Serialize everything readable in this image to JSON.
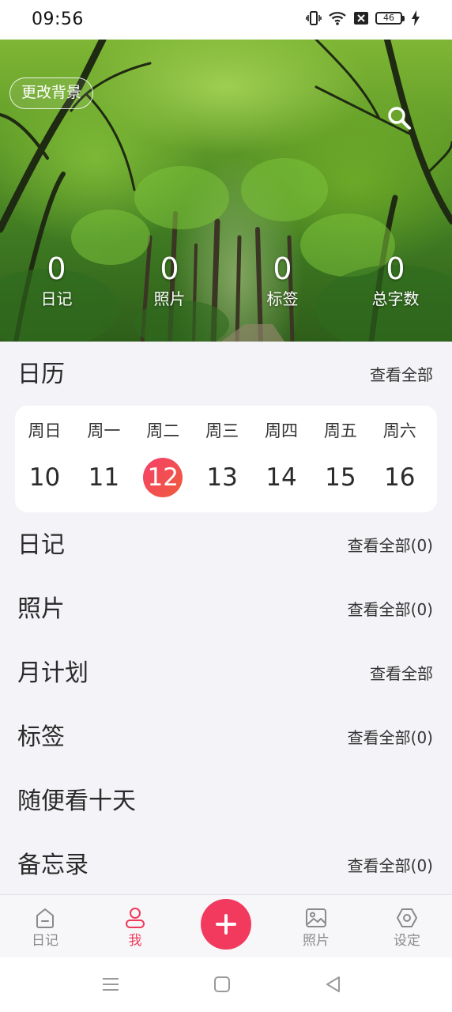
{
  "status_bar": {
    "time": "09:56",
    "battery_level": "46",
    "icons": [
      "vibrate-icon",
      "wifi-icon",
      "sim-off-icon",
      "battery-icon",
      "charging-icon"
    ]
  },
  "hero": {
    "change_background_label": "更改背景",
    "search_icon": "search-icon",
    "stats": [
      {
        "value": "0",
        "label": "日记"
      },
      {
        "value": "0",
        "label": "照片"
      },
      {
        "value": "0",
        "label": "标签"
      },
      {
        "value": "0",
        "label": "总字数"
      }
    ]
  },
  "calendar": {
    "title": "日历",
    "link": "查看全部",
    "weekdays": [
      "周日",
      "周一",
      "周二",
      "周三",
      "周四",
      "周五",
      "周六"
    ],
    "dates": [
      "10",
      "11",
      "12",
      "13",
      "14",
      "15",
      "16"
    ],
    "today": "12"
  },
  "sections": {
    "diary": {
      "title": "日记",
      "link": "查看全部(0)"
    },
    "photos": {
      "title": "照片",
      "link": "查看全部(0)"
    },
    "monthly_plan": {
      "title": "月计划",
      "link": "查看全部"
    },
    "tags": {
      "title": "标签",
      "link": "查看全部(0)"
    },
    "random_ten_days": {
      "title": "随便看十天"
    },
    "memo": {
      "title": "备忘录",
      "link": "查看全部(0)"
    }
  },
  "tab_bar": {
    "tabs": [
      {
        "label": "日记",
        "icon": "home-icon",
        "active": false
      },
      {
        "label": "我",
        "icon": "person-icon",
        "active": true
      },
      {
        "label": "",
        "icon": "plus-icon",
        "active": false
      },
      {
        "label": "照片",
        "icon": "image-icon",
        "active": false
      },
      {
        "label": "设定",
        "icon": "settings-icon",
        "active": false
      }
    ]
  },
  "colors": {
    "accent": "#f23a5e",
    "page_background": "#f4f3f7",
    "card_background": "#ffffff"
  }
}
